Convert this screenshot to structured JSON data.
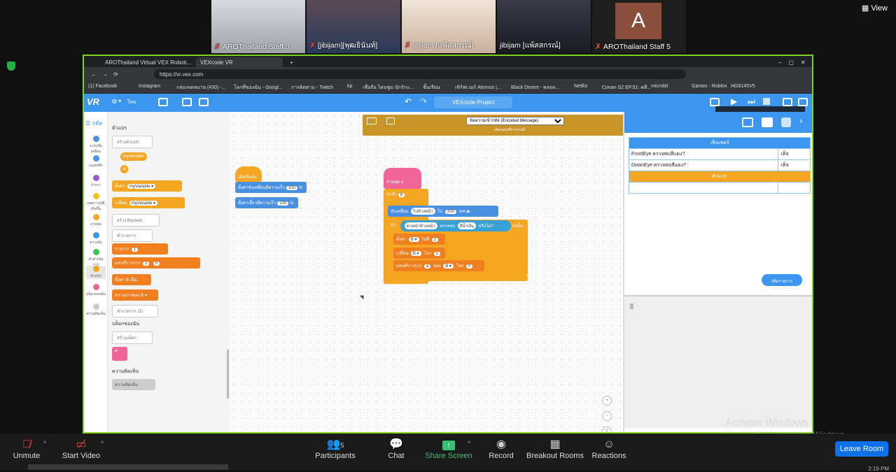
{
  "view_label": "View",
  "participants_strip": [
    {
      "name": "AROThailand Staff 3",
      "bg": "#b8bcc4"
    },
    {
      "name": "[jibijam][พุฒธินันท์]",
      "bg": "#3a4c6a"
    },
    {
      "name": "jibijam [แพ้สสกรณ์]",
      "bg": "#e8d6c8"
    },
    {
      "name": "jibijam [แพ้สสกรณ์]",
      "bg": "#2a2a36"
    },
    {
      "name": "AROThailand Staff 5",
      "bg": "#8a4f3c",
      "initial": "A"
    }
  ],
  "browser": {
    "tabs": [
      "AROThailand Virtual VEX Roboti...",
      "VEXcode VR"
    ],
    "url": "https://vr.vex.com",
    "bookmarks": [
      "(1) Facebook",
      "Instagram",
      "กล่องจดหมาย (430) -...",
      "โลกที่ของฉัน - Googl...",
      "การติดตาม - Twitch",
      "kp",
      "เชื่อถือ ไตนซูม นักรักแ...",
      "ชั้นเรียน",
      "เซิร์ฟเวอร์ Aternos |...",
      "Black Desert - พลอด...",
      "Netflix",
      "Conan S2 EP.51: คดี...",
      "microbit",
      "Games - Roblox",
      "HG8145V5"
    ]
  },
  "vexcode": {
    "logo": "VR",
    "language": "ไทย",
    "project_title": "VEXcode Project",
    "decoder_select": "ข้อความเข้ารหัส (Encoded Message)",
    "decoder_caption": "เลือกแผนที่การงานส์",
    "palette_header": "รหัส",
    "categories": [
      {
        "label": "ระบบขับเคลื่อน",
        "color": "#4a90e2"
      },
      {
        "label": "แมงเหลืก",
        "color": "#4a90e2"
      },
      {
        "label": "ปากกา",
        "color": "#9b59d0"
      },
      {
        "label": "เหตุการณ์ที่เกิดขึ้น",
        "color": "#f1c40f"
      },
      {
        "label": "ควบคุม",
        "color": "#f5a623"
      },
      {
        "label": "ตรวจจับ",
        "color": "#3a9ad9"
      },
      {
        "label": "ตัวดำเนินการ",
        "color": "#34c759"
      },
      {
        "label": "ตัวแปร",
        "color": "#f5a623"
      },
      {
        "label": "บล็อกของฉัน",
        "color": "#f06496"
      },
      {
        "label": "ความคิดเห็น",
        "color": "#ccc"
      }
    ],
    "flyout": {
      "section_variables": "ตัวแปร",
      "make_variable": "สร้างตัวแปร",
      "var_name": "myVariable",
      "var_a": "a",
      "set_label": "ตั้งค่า",
      "change_label": "เปลี่ยน",
      "make_boolean": "สร้าง Boolean",
      "make_list": "ทำรายการ",
      "make_2d_list": "ทำรายการ 2D",
      "section_myblocks": "บล็อกของฉัน",
      "make_block": "สร้างบล็อก",
      "section_comments": "ความคิดเห็น",
      "comment_block": "ความคิดเห็น"
    },
    "canvas_script1": {
      "hat": "เมื่อเริ่มต้น",
      "line1": "ตั้งค่าขับเคลื่อนที่ความเร็ว",
      "line1_value": "100",
      "line2": "ตั้งค่าเลี้ยวที่ความเร็ว",
      "line2_value": "100",
      "unit": "%"
    },
    "canvas_script2": {
      "define": "กำหนด",
      "define_arg": "a",
      "repeat": "ทำซ้ำ",
      "repeat_value": "8",
      "drive": "ขับเคลื่อน",
      "drive_dir": "ไปข้างหน้า",
      "drive_dist": "200",
      "drive_unit": "mm",
      "if_label": "ถ้า",
      "sensor": "ตาหน้าข้างหน้า",
      "detects": "ตรวจพบ",
      "color": "สีน้ำเงิน",
      "then": "หรือไม่?",
      "then2": "ดังนั้น",
      "set": "ตั้งค่า",
      "set_to": "ไปที่",
      "set_val": "1",
      "change": "เปลี่ยน",
      "change_by": "โดย",
      "change_val": "1",
      "replace": "แทนที่รายการ",
      "replace_of": "ของ",
      "replace_with": "โดย",
      "replace_val": "0"
    },
    "sensors_header": "เซ็นเซอร์",
    "sensors": [
      {
        "name": "FrontEye ตรวจพบสีแดง?",
        "value": "เท็จ"
      },
      {
        "name": "DownEye ตรวจพบสีแดง?",
        "value": "เท็จ"
      }
    ],
    "variables_header": "ตัวแปร",
    "add_sensor": "เพิ่มรายการ"
  },
  "watermark": {
    "line1": "Activate Windows",
    "line2": "Go to Settings to activate Windows."
  },
  "toolbar": {
    "unmute": "Unmute",
    "start_video": "Start Video",
    "participants": "Participants",
    "participants_count": "5",
    "chat": "Chat",
    "share_screen": "Share Screen",
    "record": "Record",
    "breakout": "Breakout Rooms",
    "reactions": "Reactions",
    "leave": "Leave Room",
    "time": "2:19 PM"
  }
}
